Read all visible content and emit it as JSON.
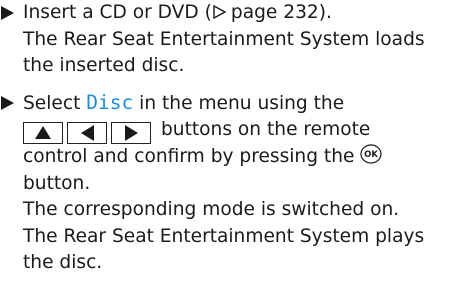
{
  "steps": [
    {
      "lines": [
        "Insert a CD or DVD (",
        "page 232).",
        "The Rear Seat Entertainment System loads",
        "the inserted disc."
      ]
    },
    {
      "lines": [
        "Select ",
        "Disc",
        " in the menu using the",
        "buttons on the remote",
        "control and confirm by pressing the",
        "button.",
        "The corresponding mode is switched on.",
        "The Rear Seat Entertainment System plays",
        "the disc."
      ],
      "ok_label": "OK"
    }
  ]
}
